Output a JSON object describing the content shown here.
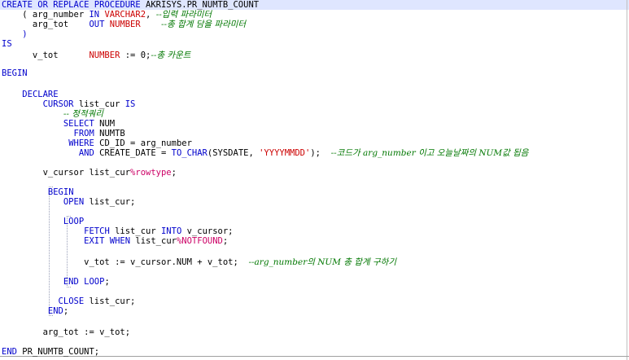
{
  "code": {
    "line1": {
      "kw1": "CREATE OR REPLACE ",
      "kw2": "PROCEDURE",
      "rest": " AKRISYS.PR_NUMTB_COUNT"
    },
    "line2": {
      "pre": "    ( arg_number ",
      "kw": "IN",
      "sp": " ",
      "ty": "VARCHAR2",
      "mid": ", ",
      "cm": "--입력 파라미터"
    },
    "line3": {
      "pre": "      arg_tot    ",
      "kw": "OUT",
      "sp": " ",
      "ty": "NUMBER",
      "gap": "    ",
      "cm": "--총 합계 담을 파라미터"
    },
    "line4": {
      "text": "    )"
    },
    "line5": {
      "kw": "IS"
    },
    "line6": {
      "pre": "      v_tot      ",
      "ty": "NUMBER",
      "mid": " := 0;",
      "cm": "--총 카운트"
    },
    "line8": {
      "kw": "BEGIN"
    },
    "line10": {
      "pre": "    ",
      "kw": "DECLARE"
    },
    "line11": {
      "pre": "        ",
      "kw": "CURSOR",
      "mid": " list_cur ",
      "kw2": "IS"
    },
    "line12": {
      "pre": "            ",
      "cm": "-- 정적쿼리"
    },
    "line13": {
      "pre": "            ",
      "kw": "SELECT",
      "rest": " NUM"
    },
    "line14": {
      "pre": "              ",
      "kw": "FROM",
      "rest": " NUMTB"
    },
    "line15": {
      "pre": "             ",
      "kw": "WHERE",
      "rest": " CD_ID = arg_number"
    },
    "line16": {
      "pre": "               ",
      "kw": "AND",
      "mid": " CREATE_DATE = ",
      "kw2": "TO_CHAR",
      "mid2": "(SYSDATE, ",
      "st": "'YYYYMMDD'",
      "end": ");  ",
      "cm": "--코드가 arg_number 이고 오늘날짜의 NUM값 됩음"
    },
    "line18": {
      "pre": "        v_cursor list_cur",
      "rt": "%rowtype",
      "end": ";"
    },
    "line20": {
      "pre": "         ",
      "kw": "BEGIN"
    },
    "line21": {
      "pre": "            ",
      "kw": "OPEN",
      "rest": " list_cur;"
    },
    "line23": {
      "pre": "            ",
      "kw": "LOOP"
    },
    "line24": {
      "pre": "                ",
      "kw": "FETCH",
      "mid": " list_cur ",
      "kw2": "INTO",
      "rest": " v_cursor;"
    },
    "line25": {
      "pre": "                ",
      "kw": "EXIT WHEN",
      "mid": " list_cur",
      "rt": "%NOTFOUND",
      "end": ";"
    },
    "line27": {
      "pre": "                v_tot := v_cursor.NUM + v_tot;  ",
      "cm": "--arg_number의 NUM 총 합계 구하기"
    },
    "line29": {
      "pre": "            ",
      "kw": "END LOOP",
      "end": ";"
    },
    "line31": {
      "pre": "           ",
      "kw": "CLOSE",
      "rest": " list_cur;"
    },
    "line32": {
      "pre": "         ",
      "kw": "END",
      "end": ";"
    },
    "line34": {
      "pre": "        arg_tot := v_tot;"
    },
    "line36": {
      "kw": "END",
      "rest": " PR_NUMTB_COUNT;"
    }
  }
}
